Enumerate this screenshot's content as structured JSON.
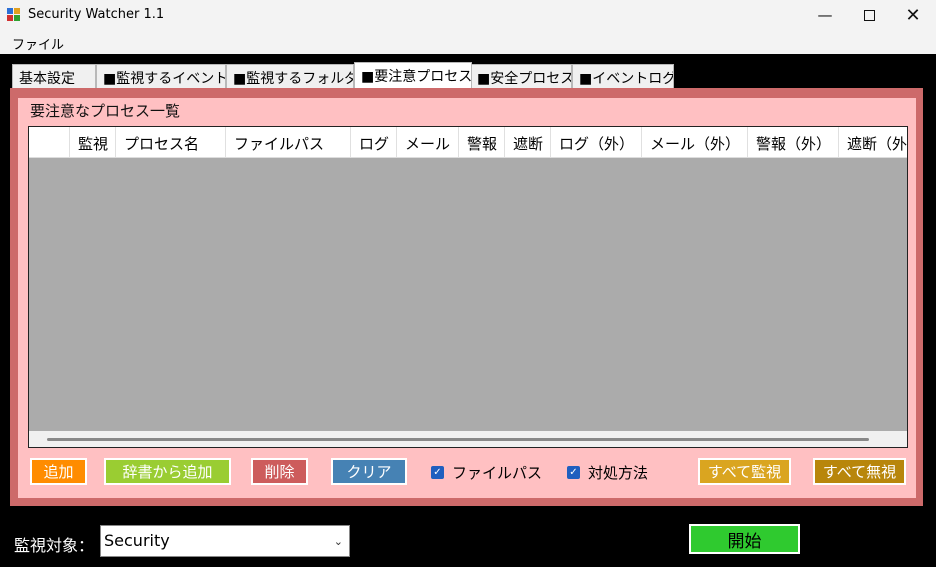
{
  "window": {
    "title": "Security Watcher 1.1"
  },
  "menu": {
    "file": "ファイル"
  },
  "tabs": [
    {
      "label": "基本設定"
    },
    {
      "label": "■監視するイベント"
    },
    {
      "label": "■監視するフォルダ"
    },
    {
      "label": "■要注意プロセス"
    },
    {
      "label": "■安全プロセス"
    },
    {
      "label": "■イベントログ"
    }
  ],
  "active_tab": "■要注意プロセス",
  "group": {
    "title": "要注意なプロセス一覧"
  },
  "grid": {
    "columns": [
      "",
      "監視",
      "プロセス名",
      "ファイルパス",
      "ログ",
      "メール",
      "警報",
      "遮断",
      "ログ（外）",
      "メール（外）",
      "警報（外）",
      "遮断（外）"
    ],
    "rows": []
  },
  "buttons": {
    "add": "追加",
    "add_from_dict": "辞書から追加",
    "delete": "削除",
    "clear": "クリア",
    "monitor_all": "すべて監視",
    "ignore_all": "すべて無視"
  },
  "checkboxes": {
    "file_path": {
      "label": "ファイルパス",
      "checked": true
    },
    "countermeasure": {
      "label": "対処方法",
      "checked": true
    }
  },
  "bottom": {
    "target_label": "監視対象：",
    "target_value": "Security",
    "start": "開始"
  },
  "colors": {
    "panel_border": "#cd6a6a",
    "panel_bg": "#ffc0c2",
    "grid_bg": "#ababab",
    "add": "#ff8c00",
    "add_from_dict": "#9acd32",
    "delete": "#cd5c5c",
    "clear": "#4682b4",
    "monitor_all": "#daa520",
    "ignore_all": "#b8860b",
    "start": "#2fca2f"
  }
}
